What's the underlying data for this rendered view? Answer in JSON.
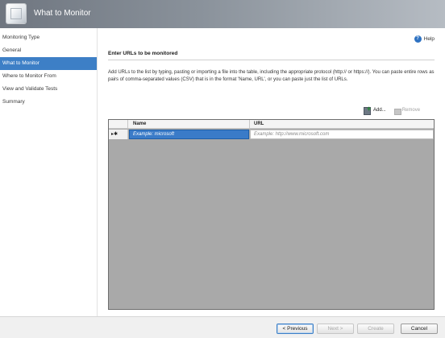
{
  "window": {
    "title": "What to Monitor"
  },
  "sidebar": {
    "items": [
      {
        "label": "Monitoring Type",
        "active": false
      },
      {
        "label": "General",
        "active": false
      },
      {
        "label": "What to Monitor",
        "active": true
      },
      {
        "label": "Where to Monitor From",
        "active": false
      },
      {
        "label": "View and Validate Tests",
        "active": false
      },
      {
        "label": "Summary",
        "active": false
      }
    ]
  },
  "main": {
    "help_label": "Help",
    "section_title": "Enter URLs to be monitored",
    "description": "Add URLs to the list by typing, pasting or importing a file into the table, including the appropriate protocol (http:// or https://). You can paste entire rows as pairs of comma-separated values (CSV) that is in the format 'Name, URL', or you can paste just the list of URLs.",
    "add_label": "Add...",
    "remove_label": "Remove"
  },
  "grid": {
    "columns": [
      "Name",
      "URL"
    ],
    "rows": [
      {
        "marker": "▸✱",
        "name": "Example: microsoft",
        "url": "Example: http://www.microsoft.com"
      }
    ]
  },
  "footer": {
    "previous_label": "< Previous",
    "next_label": "Next >",
    "create_label": "Create",
    "cancel_label": "Cancel"
  },
  "colors": {
    "accent": "#3d7fc6",
    "header_start": "#6f7680",
    "header_end": "#b6bcc3",
    "grid_background": "#a9a9a9"
  },
  "icons": {
    "wizard": "wizard-icon",
    "help": "help-icon",
    "add": "add-icon",
    "remove": "remove-icon"
  }
}
